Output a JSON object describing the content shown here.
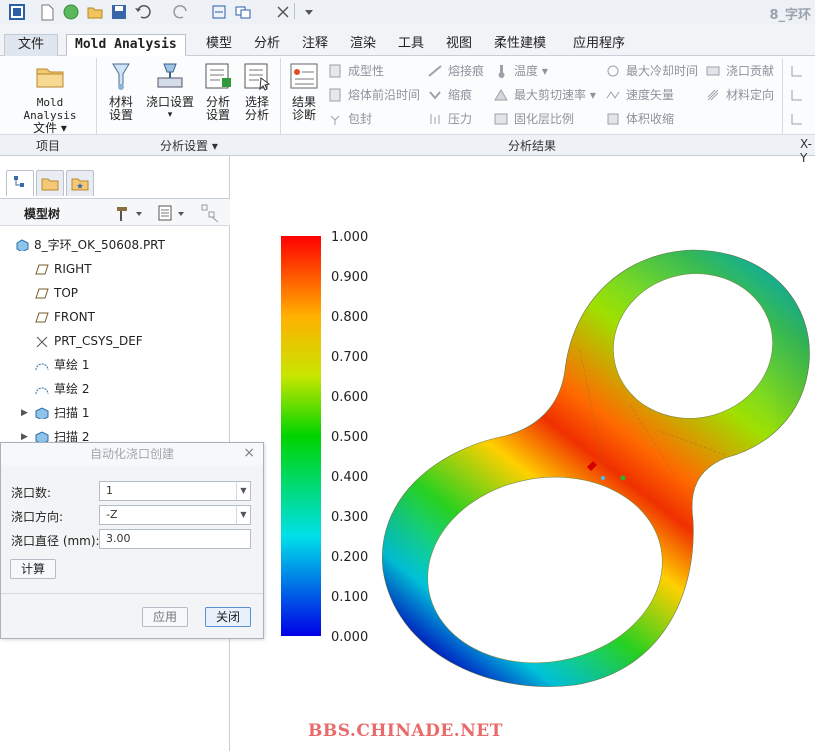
{
  "window": {
    "title_fragment": "8_字环"
  },
  "tabs": [
    {
      "label": "文件"
    },
    {
      "label": "Mold Analysis"
    },
    {
      "label": "模型"
    },
    {
      "label": "分析"
    },
    {
      "label": "注释"
    },
    {
      "label": "渲染"
    },
    {
      "label": "工具"
    },
    {
      "label": "视图"
    },
    {
      "label": "柔性建模"
    },
    {
      "label": "应用程序"
    }
  ],
  "ribbon": {
    "project": {
      "button_line1": "Mold Analysis",
      "button_line2": "文件",
      "group": "项目"
    },
    "analysis_setup": {
      "group": "分析设置",
      "material": [
        "材料",
        "设置"
      ],
      "gate": [
        "浇口设置"
      ],
      "analysis": [
        "分析",
        "设置"
      ],
      "select": [
        "选择",
        "分析"
      ]
    },
    "results": {
      "group": "分析结果",
      "diagnose": [
        "结果",
        "诊断"
      ],
      "col1": [
        "成型性",
        "熔体前沿时间",
        "包封"
      ],
      "col2": [
        "熔接痕",
        "缩痕",
        "压力"
      ],
      "col3": [
        "温度",
        "最大剪切速率",
        "固化层比例"
      ],
      "col4": [
        "最大冷却时间",
        "速度矢量",
        "体积收缩"
      ],
      "col5": [
        "浇口贡献",
        "材料定向"
      ],
      "next_group": "X-Y"
    }
  },
  "model_tree": {
    "title": "模型树",
    "items": [
      {
        "label": "8_字环_OK_50608.PRT",
        "icon": "part-icon"
      },
      {
        "label": "RIGHT",
        "icon": "datum-plane-icon"
      },
      {
        "label": "TOP",
        "icon": "datum-plane-icon"
      },
      {
        "label": "FRONT",
        "icon": "datum-plane-icon"
      },
      {
        "label": "PRT_CSYS_DEF",
        "icon": "csys-icon"
      },
      {
        "label": "草绘 1",
        "icon": "sketch-icon"
      },
      {
        "label": "草绘 2",
        "icon": "sketch-icon"
      },
      {
        "label": "扫描 1",
        "icon": "sweep-icon"
      },
      {
        "label": "扫描 2",
        "icon": "sweep-icon"
      }
    ]
  },
  "dialog": {
    "title": "自动化浇口创建",
    "gate_count_label": "浇口数:",
    "gate_count_value": "1",
    "gate_direction_label": "浇口方向:",
    "gate_direction_value": "-Z",
    "gate_diameter_label": "浇口直径 (mm):",
    "gate_diameter_value": "3.00",
    "calc_button": "计算",
    "apply_button": "应用",
    "close_button": "关闭"
  },
  "legend": {
    "labels": [
      "1.000",
      "0.900",
      "0.800",
      "0.700",
      "0.600",
      "0.500",
      "0.400",
      "0.300",
      "0.200",
      "0.100",
      "0.000"
    ],
    "colors": {
      "top": "#ff0000",
      "upper": "#ffb000",
      "mid_upper": "#c8e600",
      "mid": "#00d400",
      "lower": "#00e0e8",
      "bottom": "#0000e6"
    }
  },
  "watermark": "BBS.CHINADE.NET"
}
